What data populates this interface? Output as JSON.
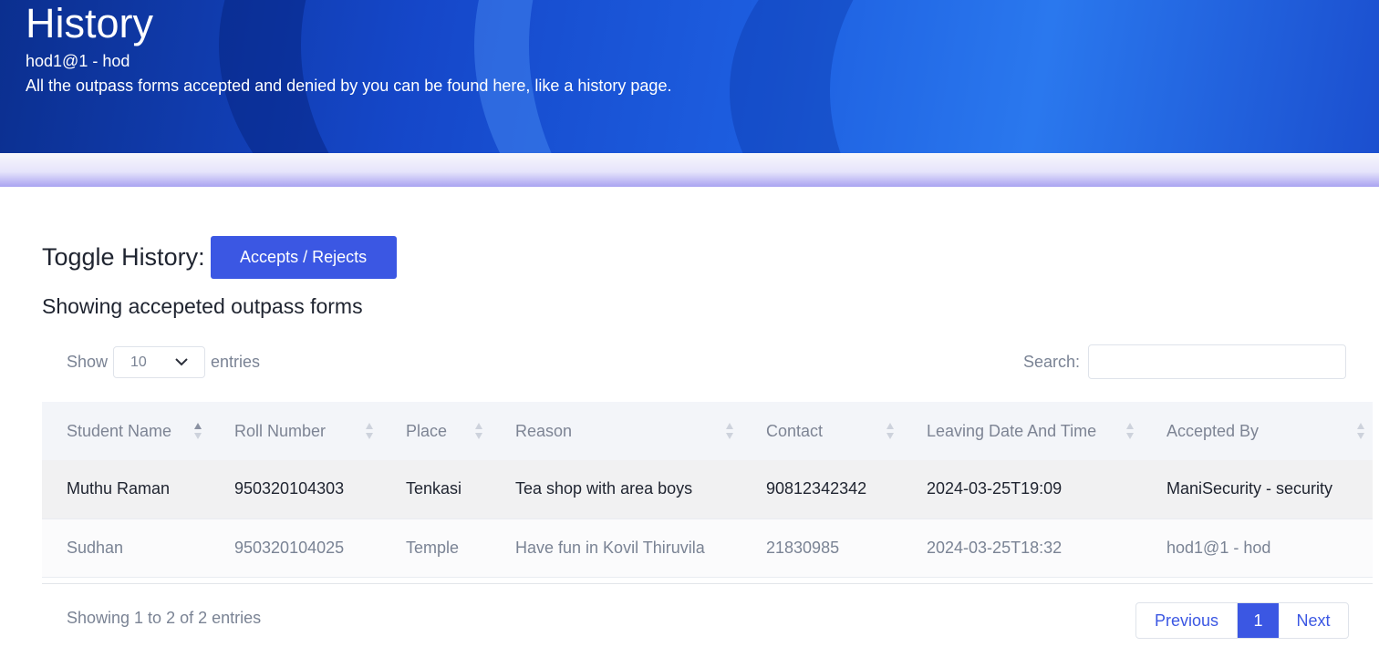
{
  "header": {
    "title": "History",
    "user": "hod1@1 - hod",
    "description": "All the outpass forms accepted and denied by you can be found here, like a history page."
  },
  "toggle": {
    "label": "Toggle History:",
    "button_label": "Accepts / Rejects"
  },
  "section_title": "Showing accepeted outpass forms",
  "length_menu": {
    "show_label": "Show",
    "selected": "10",
    "entries_label": "entries"
  },
  "search": {
    "label": "Search:",
    "value": ""
  },
  "table": {
    "columns": [
      "Student Name",
      "Roll Number",
      "Place",
      "Reason",
      "Contact",
      "Leaving Date And Time",
      "Accepted By"
    ],
    "sorted_column": "Student Name",
    "rows": [
      [
        "Muthu Raman",
        "950320104303",
        "Tenkasi",
        "Tea shop with area boys",
        "90812342342",
        "2024-03-25T19:09",
        "ManiSecurity - security"
      ],
      [
        "Sudhan",
        "950320104025",
        "Temple",
        "Have fun in Kovil Thiruvila",
        "21830985",
        "2024-03-25T18:32",
        "hod1@1 - hod"
      ]
    ]
  },
  "footer": {
    "info": "Showing 1 to 2 of 2 entries"
  },
  "pagination": {
    "previous": "Previous",
    "current": "1",
    "next": "Next"
  },
  "colors": {
    "primary": "#3b57e3",
    "banner": "#1547c9"
  }
}
